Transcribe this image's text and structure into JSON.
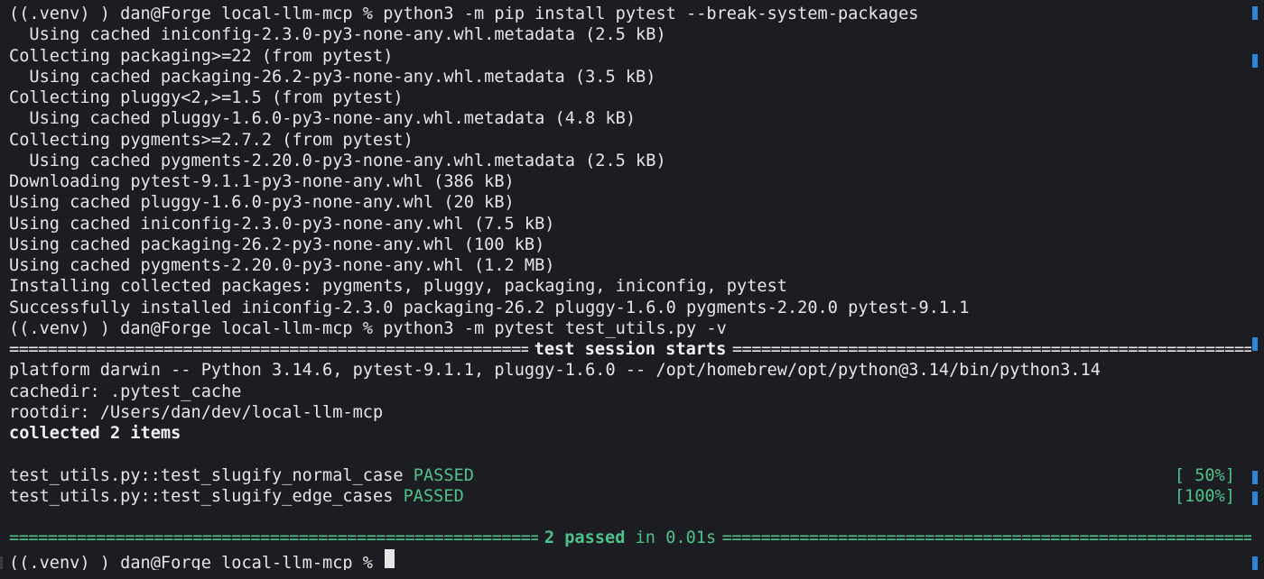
{
  "terminal": {
    "line1": "((.venv) ) dan@Forge local-llm-mcp % python3 -m pip install pytest --break-system-packages",
    "line2": "  Using cached iniconfig-2.3.0-py3-none-any.whl.metadata (2.5 kB)",
    "line3": "Collecting packaging>=22 (from pytest)",
    "line4": "  Using cached packaging-26.2-py3-none-any.whl.metadata (3.5 kB)",
    "line5": "Collecting pluggy<2,>=1.5 (from pytest)",
    "line6": "  Using cached pluggy-1.6.0-py3-none-any.whl.metadata (4.8 kB)",
    "line7": "Collecting pygments>=2.7.2 (from pytest)",
    "line8": "  Using cached pygments-2.20.0-py3-none-any.whl.metadata (2.5 kB)",
    "line9": "Downloading pytest-9.1.1-py3-none-any.whl (386 kB)",
    "line10": "Using cached pluggy-1.6.0-py3-none-any.whl (20 kB)",
    "line11": "Using cached iniconfig-2.3.0-py3-none-any.whl (7.5 kB)",
    "line12": "Using cached packaging-26.2-py3-none-any.whl (100 kB)",
    "line13": "Using cached pygments-2.20.0-py3-none-any.whl (1.2 MB)",
    "line14": "Installing collected packages: pygments, pluggy, packaging, iniconfig, pytest",
    "line15": "Successfully installed iniconfig-2.3.0 packaging-26.2 pluggy-1.6.0 pygments-2.20.0 pytest-9.1.1",
    "line16": "((.venv) ) dan@Forge local-llm-mcp % python3 -m pytest test_utils.py -v",
    "session_label": "test session starts",
    "line18": "platform darwin -- Python 3.14.6, pytest-9.1.1, pluggy-1.6.0 -- /opt/homebrew/opt/python@3.14/bin/python3.14",
    "line19": "cachedir: .pytest_cache",
    "line20": "rootdir: /Users/dan/dev/local-llm-mcp",
    "line21": "collected 2 items",
    "tests": [
      {
        "name": "test_utils.py::test_slugify_normal_case",
        "status": "PASSED",
        "progress": "[ 50%]"
      },
      {
        "name": "test_utils.py::test_slugify_edge_cases",
        "status": "PASSED",
        "progress": "[100%]"
      }
    ],
    "summary_passed": "2 passed",
    "summary_rest": "in 0.01s",
    "prompt": "((.venv) ) dan@Forge local-llm-mcp %"
  },
  "colors": {
    "background": "#1c1d22",
    "text": "#e6e6e6",
    "passed_green": "#4fc18a",
    "scroll_marker_blue": "#2f86d6"
  }
}
